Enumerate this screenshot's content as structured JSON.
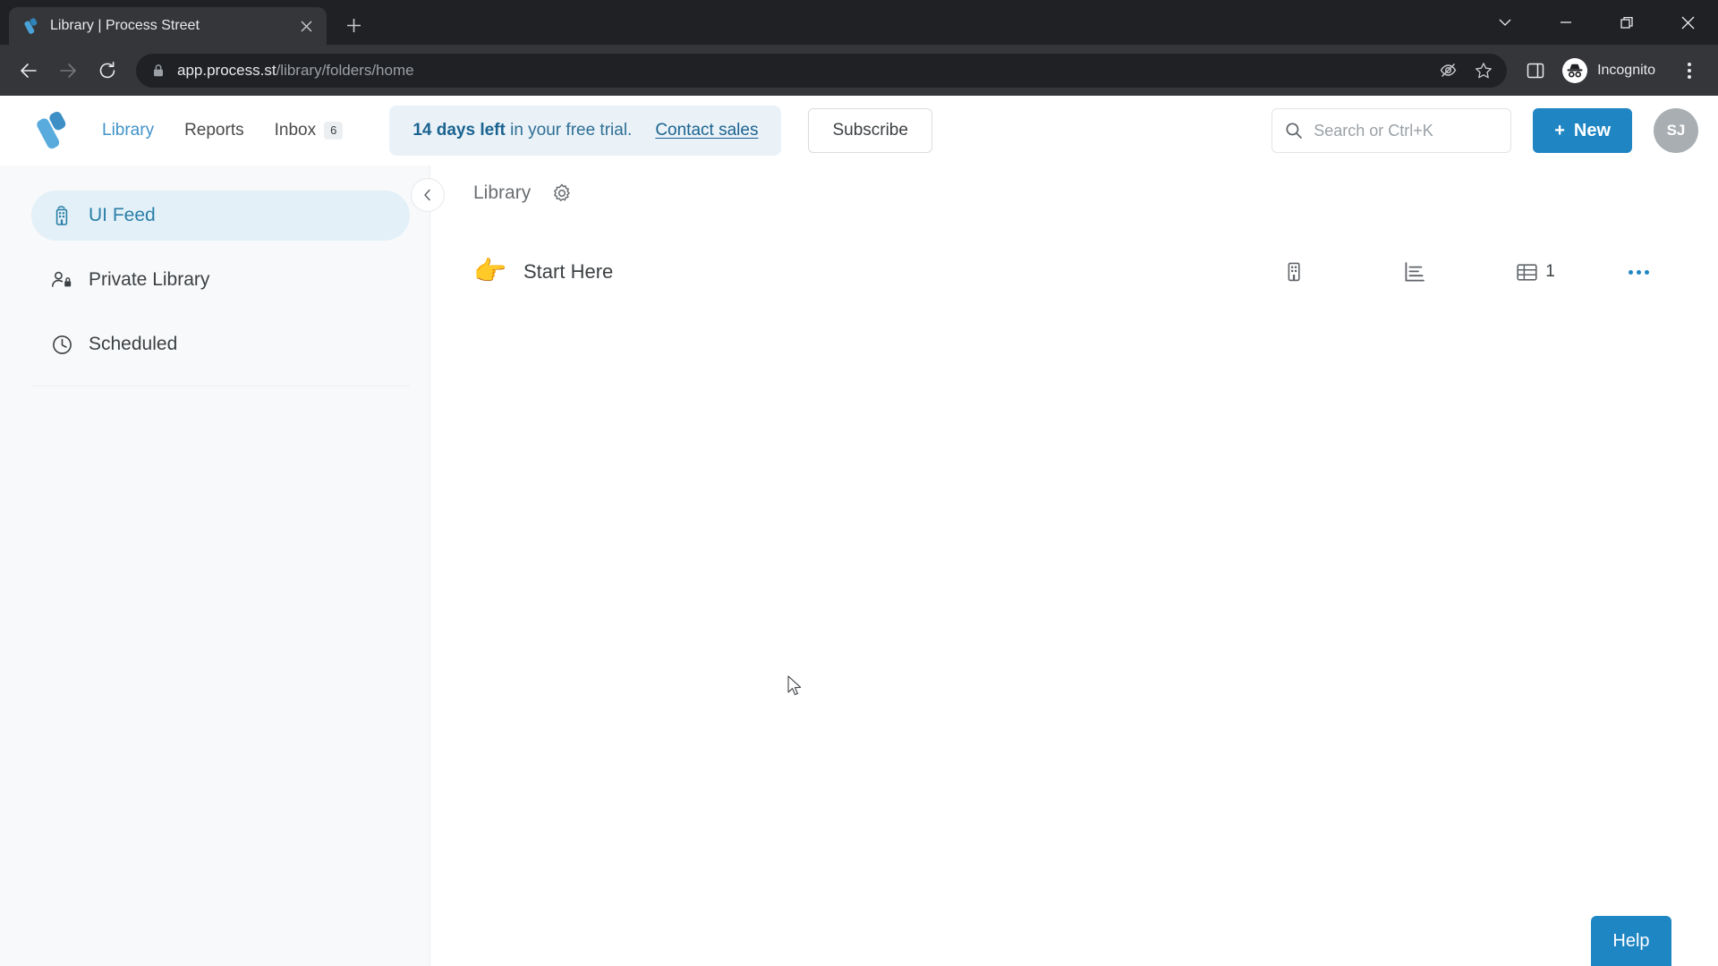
{
  "browser": {
    "tab": {
      "title": "Library | Process Street",
      "favicon_name": "process-street-favicon",
      "close_label": "✕"
    },
    "new_tab_label": "+",
    "window_controls": [
      {
        "name": "tab-search",
        "glyph": "⌄"
      },
      {
        "name": "minimize",
        "glyph": "—"
      },
      {
        "name": "maximize",
        "glyph": "❐"
      },
      {
        "name": "close",
        "glyph": "✕"
      }
    ],
    "nav": {
      "back_label": "←",
      "forward_label": "→",
      "reload_label": "↻"
    },
    "omnibox": {
      "lock_icon": "lock-icon",
      "url_domain": "app.process.st",
      "url_path": "/library/folders/home",
      "icons": [
        "third-party-cookie-blocked-icon",
        "bookmark-star-icon"
      ]
    },
    "side_panel_label": "side-panel-icon",
    "incognito_label": "Incognito",
    "menu_label": "chrome-menu-icon"
  },
  "app": {
    "brand_name": "process-street-logo",
    "nav_links": [
      {
        "label": "Library",
        "active": true,
        "badge": ""
      },
      {
        "label": "Reports",
        "active": false,
        "badge": ""
      },
      {
        "label": "Inbox",
        "active": false,
        "badge": "6"
      }
    ],
    "trial": {
      "days_bold": "14 days left",
      "rest": " in your free trial.",
      "link": "Contact sales"
    },
    "subscribe_label": "Subscribe",
    "search": {
      "placeholder": "Search or Ctrl+K",
      "value": ""
    },
    "new_button": {
      "plus": "+",
      "label": "New"
    },
    "avatar_initials": "SJ",
    "sidebar": {
      "items": [
        {
          "label": "UI Feed",
          "icon": "building-feed-icon",
          "active": true
        },
        {
          "label": "Private Library",
          "icon": "person-lock-icon",
          "active": false
        },
        {
          "label": "Scheduled",
          "icon": "clock-icon",
          "active": false
        }
      ]
    },
    "collapse_label": "‹",
    "breadcrumb": "Library",
    "settings_icon": "gear-icon",
    "rows": [
      {
        "emoji": "👉",
        "title": "Start Here",
        "org_icon": "building-icon",
        "report_icon": "bar-chart-report-icon",
        "table_icon": "data-set-table-icon",
        "table_count": "1",
        "more_icon": "more-options-icon"
      }
    ],
    "help_label": "Help"
  },
  "colors": {
    "accent": "#2086c3",
    "trial_bg": "#eaf2f8",
    "trial_text": "#2e6f94",
    "sidebar_active_bg": "#e3f0f7",
    "sidebar_active_text": "#2a7fa8",
    "sidebar_bg": "#f8f9fa",
    "chrome_dark": "#202124",
    "chrome_tab": "#35363a",
    "help_bg": "#1f86c4"
  }
}
